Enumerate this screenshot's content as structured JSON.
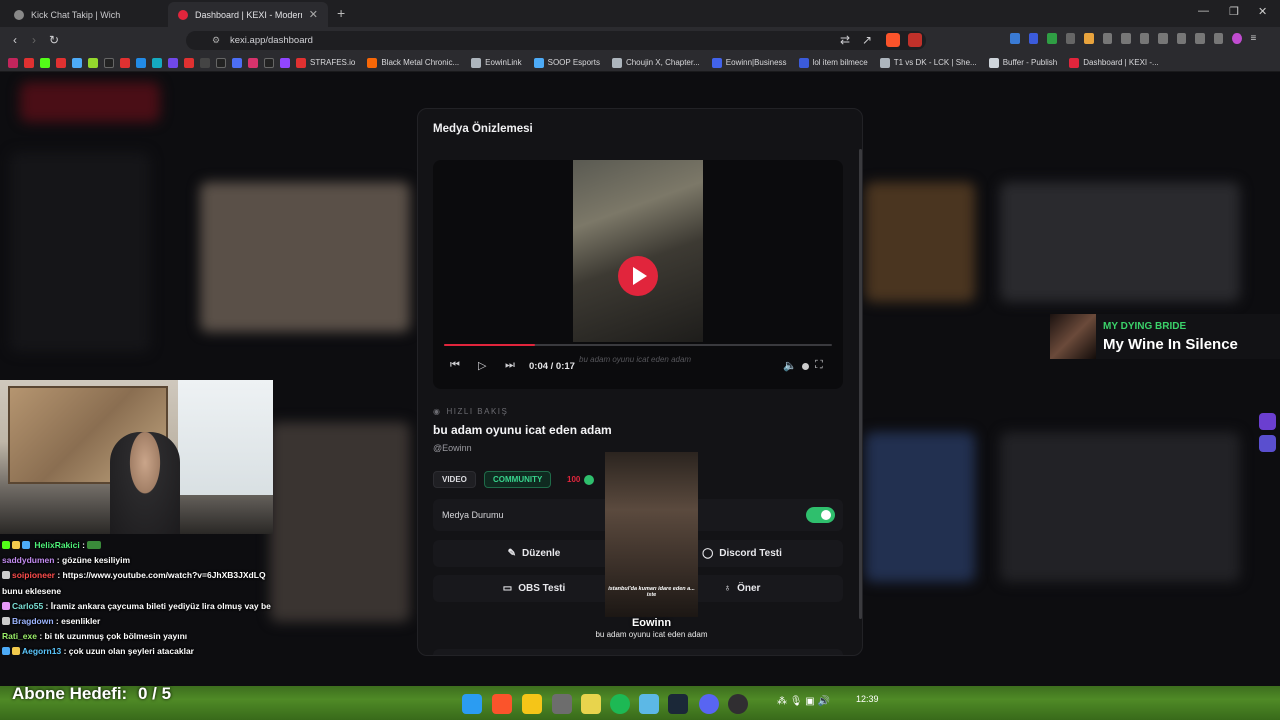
{
  "browser": {
    "tabs": [
      {
        "title": "Kick Chat Takip | Wich"
      },
      {
        "title": "Dashboard | KEXI - Modern Strea"
      }
    ],
    "url": "kexi.app/dashboard",
    "bookmarks": [
      "STRAFES.io",
      "Black Metal Chronic...",
      "EowinLink",
      "SOOP Esports",
      "Choujin X, Chapter...",
      "Eowinn|Business",
      "lol item bilmece",
      "T1 vs DK - LCK | She...",
      "Buffer - Publish",
      "Dashboard | KEXI -..."
    ]
  },
  "modal": {
    "title": "Medya Önizlemesi",
    "player": {
      "time": "0:04 / 0:17",
      "caption_ghost": "bu adam oyunu icat eden adam",
      "progress": 0.235
    },
    "quick_view_label": "HIZLI BAKIŞ",
    "media_title": "bu adam oyunu icat eden adam",
    "author": "@Eowinn",
    "chips": {
      "video": "VIDEO",
      "community": "COMMUNITY",
      "score": "100"
    },
    "status_label": "Medya Durumu",
    "status_on": true,
    "buttons": {
      "edit": "Düzenle",
      "discord": "Discord Testi",
      "obs": "OBS Testi",
      "suggest": "Öner"
    }
  },
  "overlay": {
    "subtitle": "istanbul'da kumarı idare eden a... iste",
    "name": "Eowinn",
    "caption": "bu adam oyunu icat eden adam"
  },
  "now_playing": {
    "artist": "MY DYING BRIDE",
    "track": "My Wine In Silence"
  },
  "chat": [
    {
      "user": "HelixRakici",
      "user_color": "#4ff27a",
      "msg": ""
    },
    {
      "user": "saddydumen",
      "user_color": "#c28bf0",
      "msg": "gözüne kesiliyim"
    },
    {
      "user": "soipioneer",
      "user_color": "#ff4d4d",
      "msg": "https://www.youtube.com/watch?v=6JhXB3JXdLQ bunu eklesene"
    },
    {
      "user": "Carlo55",
      "user_color": "#7be0d6",
      "msg": "İramiz ankara çaycuma bileti yediyüz lira olmuş vay be"
    },
    {
      "user": "Bragdown",
      "user_color": "#9db5ff",
      "msg": "esenlikler"
    },
    {
      "user": "Rati_exe",
      "user_color": "#9bf06a",
      "msg": "bi tık uzunmuş çok bölmesin yayını"
    },
    {
      "user": "Aegorn13",
      "user_color": "#5cc8ff",
      "msg": "çok uzun olan şeyleri atacaklar"
    }
  ],
  "sub_goal": {
    "label": "Abone Hedefi:",
    "value": "0 / 5"
  },
  "taskbar": {
    "time": "12:39"
  },
  "colors": {
    "accent": "#e1253c",
    "toggle_on": "#2fbf6d",
    "community": "#38d38c",
    "np_artist": "#3bd26a"
  }
}
